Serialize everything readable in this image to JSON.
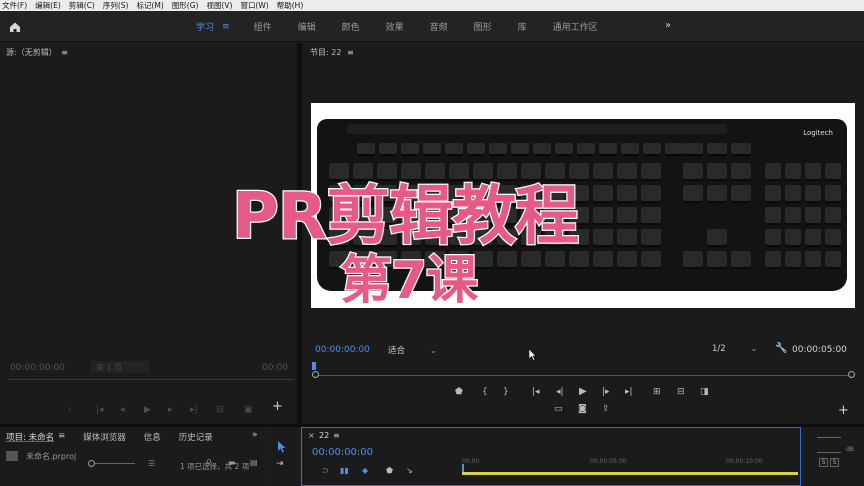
{
  "menu": [
    "文件(F)",
    "编辑(E)",
    "剪辑(C)",
    "序列(S)",
    "标记(M)",
    "图形(G)",
    "视图(V)",
    "窗口(W)",
    "帮助(H)"
  ],
  "workspaces": {
    "tabs": [
      "学习",
      "组件",
      "编辑",
      "颜色",
      "效果",
      "音频",
      "图形",
      "库",
      "通用工作区"
    ],
    "active": "学习",
    "more": "»"
  },
  "source_panel": {
    "title": "源:（无剪辑）",
    "menu": "≡",
    "timecode_left": "00:00:00:00",
    "page_label": "第 1 页",
    "timecode_right": "00:00"
  },
  "program_panel": {
    "title": "节目: 22",
    "menu": "≡",
    "timecode_current": "00:00:00:00",
    "fit_label": "适合",
    "resolution": "1/2",
    "timecode_duration": "00:00:05:00"
  },
  "overlay": {
    "line1": "PR剪辑教程",
    "line2": "第7课"
  },
  "keyboard": {
    "brand": "Logitech"
  },
  "project_panel": {
    "tabs": [
      "项目: 未命名",
      "媒体浏览器",
      "信息",
      "历史记录"
    ],
    "menu": "≡",
    "more": "»",
    "file": "未命名.prproj",
    "status": "1 项已选择，共 2 项"
  },
  "timeline_panel": {
    "close": "×",
    "sequence": "22",
    "menu": "≡",
    "timecode": "00:00:00:00",
    "ruler": [
      "00:00",
      "00:00:05:00",
      "00:00:10:00"
    ]
  },
  "meter_panel": {
    "db_label": "dB",
    "solo_labels": [
      "S",
      "S"
    ]
  },
  "colors": {
    "accent": "#4d8fe8",
    "overlay_text": "#e85a86",
    "background": "#1d1d1d"
  }
}
